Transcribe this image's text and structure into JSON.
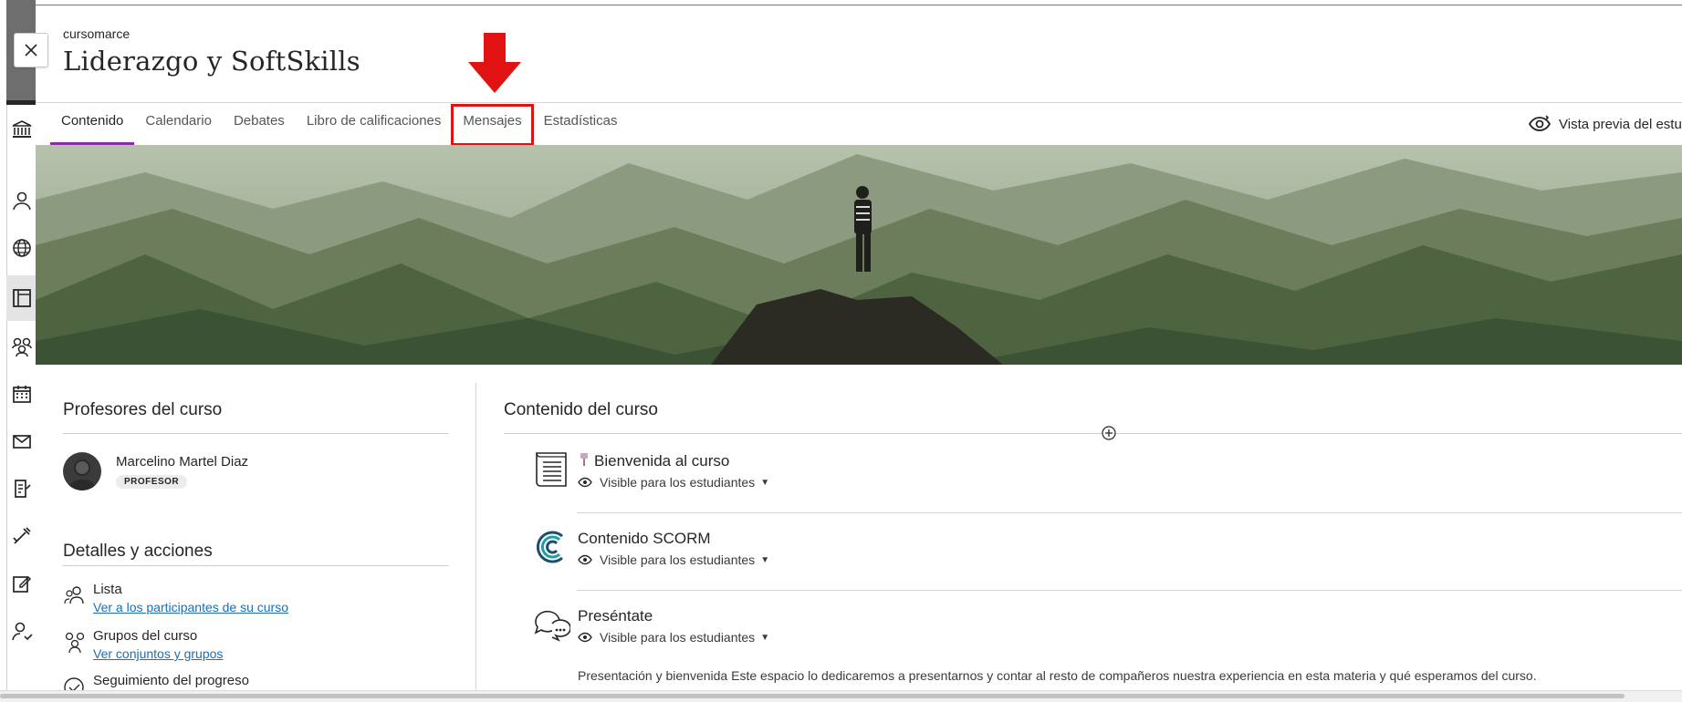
{
  "header": {
    "org_name": "cursomarce",
    "course_title": "Liderazgo y SoftSkills"
  },
  "tabs": [
    {
      "label": "Contenido",
      "active": true
    },
    {
      "label": "Calendario"
    },
    {
      "label": "Debates"
    },
    {
      "label": "Libro de calificaciones"
    },
    {
      "label": "Mensajes",
      "highlighted": true
    },
    {
      "label": "Estadísticas"
    }
  ],
  "preview": {
    "label": "Vista previa del estu",
    "icon": "eye-refresh-icon"
  },
  "rail_icons": [
    "institution-icon",
    "user-icon",
    "globe-icon",
    "courses-icon",
    "groups-icon",
    "calendar-icon",
    "mail-icon",
    "grades-icon",
    "tools-icon",
    "edit-icon",
    "profile-icon"
  ],
  "left": {
    "teachers_title": "Profesores del curso",
    "teacher": {
      "name": "Marcelino Martel Diaz",
      "role": "PROFESOR"
    },
    "details_title": "Detalles y acciones",
    "details": [
      {
        "label": "Lista",
        "link": "Ver a los participantes de su curso",
        "icon": "roster-icon"
      },
      {
        "label": "Grupos del curso",
        "link": "Ver conjuntos y grupos",
        "icon": "course-groups-icon"
      },
      {
        "label": "Seguimiento del progreso",
        "icon": "progress-check-icon"
      }
    ]
  },
  "content": {
    "title": "Contenido del curso",
    "items": [
      {
        "title": "Bienvenida al curso",
        "visibility": "Visible para los estudiantes",
        "icon": "document-icon",
        "emoji": "pin"
      },
      {
        "title": "Contenido SCORM",
        "visibility": "Visible para los estudiantes",
        "icon": "scorm-icon"
      },
      {
        "title": "Preséntate",
        "visibility": "Visible para los estudiantes",
        "icon": "discussion-icon",
        "description": "Presentación y bienvenida Este espacio lo dedicaremos a presentarnos y contar al resto de compañeros nuestra experiencia en esta materia y qué esperamos del curso."
      }
    ]
  },
  "colors": {
    "active_tab_underline": "#8a2da5",
    "highlight_red": "#e11212",
    "link": "#1a6fb5"
  }
}
